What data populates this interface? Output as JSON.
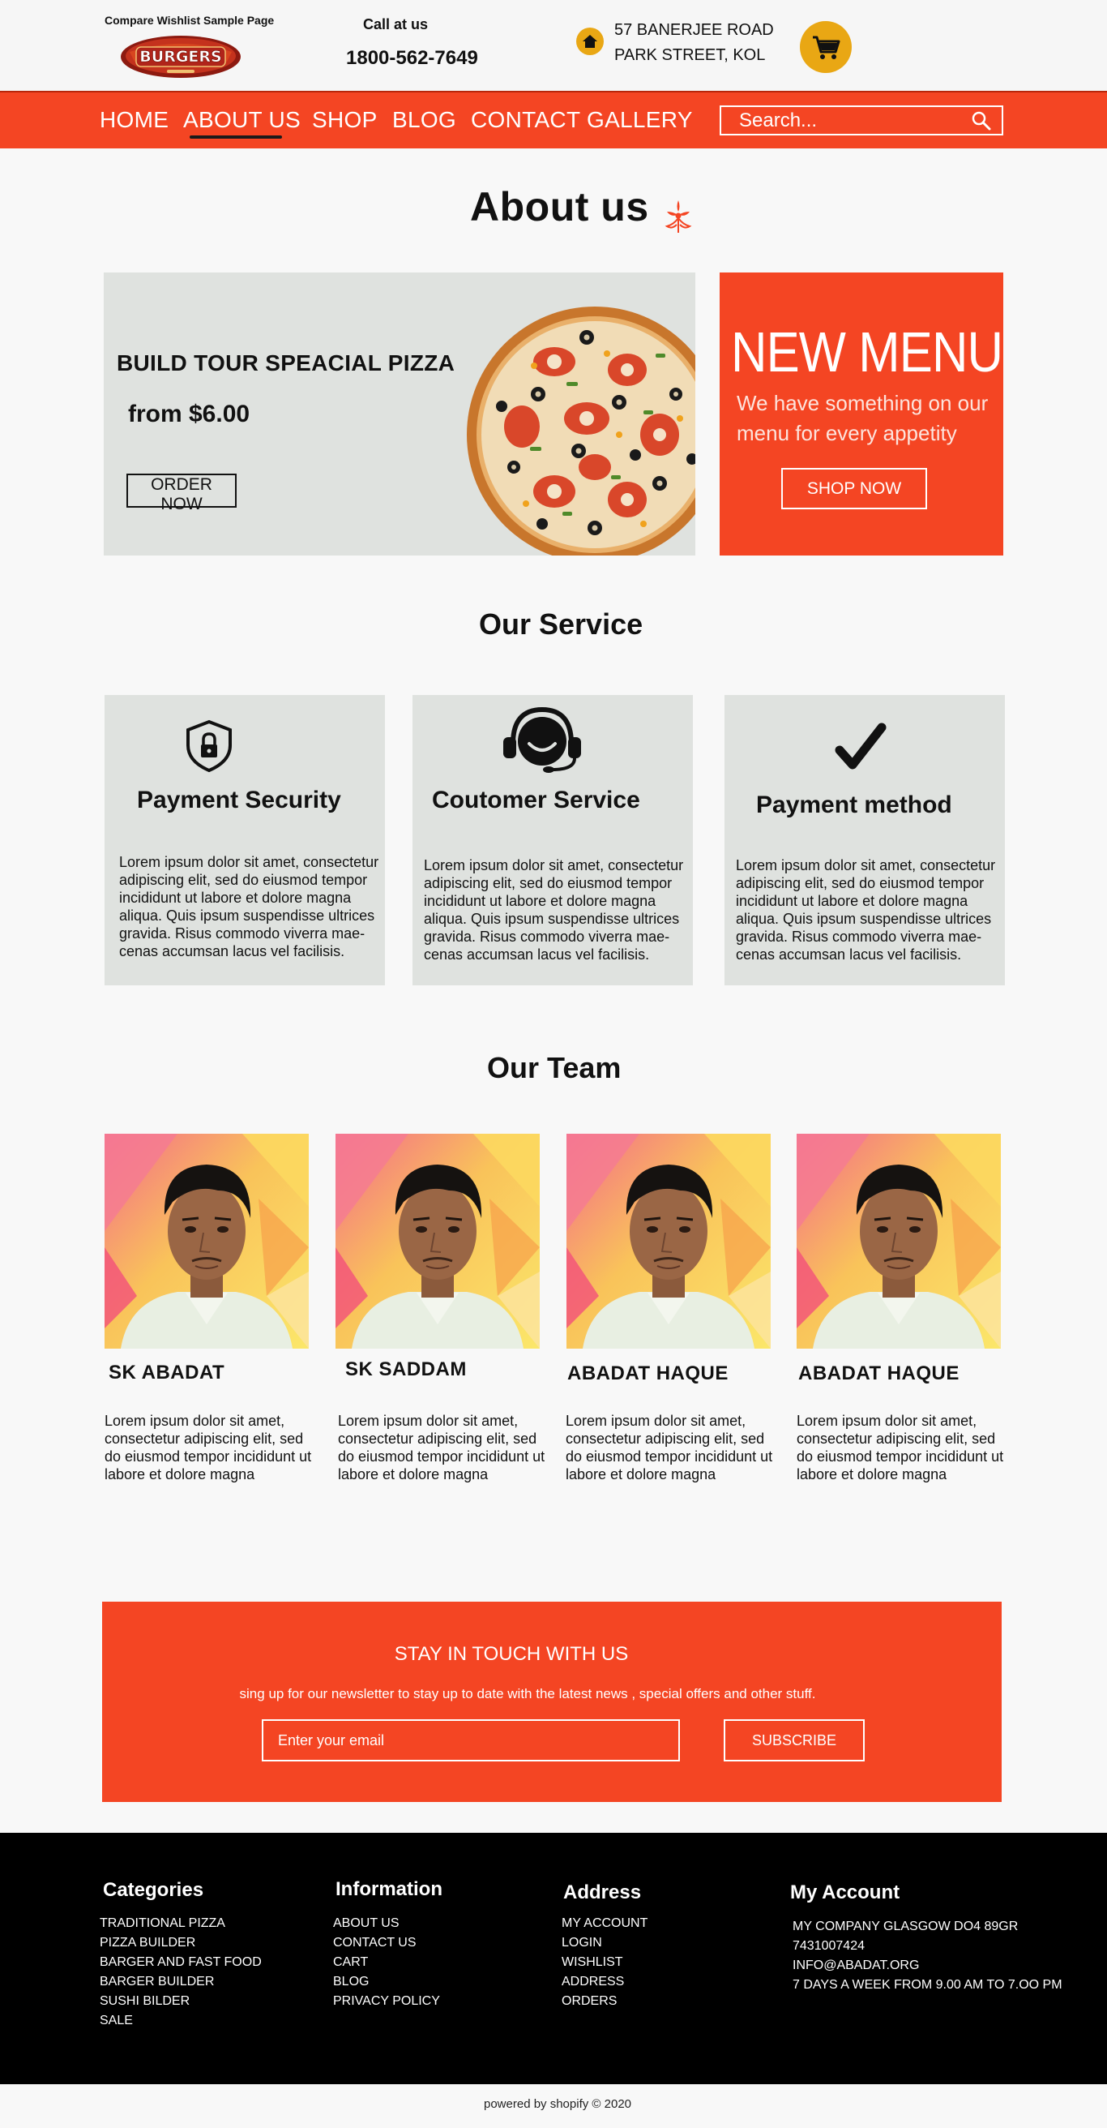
{
  "header": {
    "wishlist_text": "Compare Wishlist Sample Page",
    "logo_text": "BURGERS",
    "call_label": "Call at us",
    "phone": "1800-562-7649",
    "address_line1": "57 BANERJEE ROAD",
    "address_line2": "PARK STREET, KOL"
  },
  "nav": {
    "items": [
      {
        "label": "HOME"
      },
      {
        "label": "ABOUT US"
      },
      {
        "label": "SHOP"
      },
      {
        "label": "BLOG"
      },
      {
        "label": "CONTACT"
      },
      {
        "label": "GALLERY"
      }
    ],
    "active": "ABOUT US",
    "search_placeholder": "Search..."
  },
  "about": {
    "title": "About us"
  },
  "promo": {
    "title": "BUILD TOUR SPEACIAL PIZZA",
    "price": "from $6.00",
    "button": "ORDER NOW"
  },
  "new_menu": {
    "title": "NEW MENU",
    "text": "We have something on our menu for every appetity",
    "button": "SHOP NOW"
  },
  "services": {
    "title": "Our Service",
    "items": [
      {
        "title": "Payment Security",
        "icon": "shield-lock-icon",
        "text": "Lorem ipsum dolor sit amet, consectetur adipiscing elit, sed do eiusmod tempor incididunt ut labore et dolore magna aliqua. Quis ipsum suspendisse ultrices gravida. Risus commodo viverra mae-cenas accumsan lacus vel facilisis."
      },
      {
        "title": "Coutomer Service",
        "icon": "headset-icon",
        "text": "Lorem ipsum dolor sit amet, consectetur adipiscing elit, sed do eiusmod tempor incididunt ut labore et dolore magna aliqua. Quis ipsum suspendisse ultrices gravida. Risus commodo viverra mae-cenas accumsan lacus vel facilisis."
      },
      {
        "title": "Payment method",
        "icon": "checkmark-icon",
        "text": "Lorem ipsum dolor sit amet, consectetur adipiscing elit, sed do eiusmod tempor incididunt ut labore et dolore magna aliqua. Quis ipsum suspendisse ultrices gravida. Risus commodo viverra mae-cenas accumsan lacus vel facilisis."
      }
    ]
  },
  "team": {
    "title": "Our Team",
    "members": [
      {
        "name": "SK ABADAT",
        "text": "Lorem ipsum dolor sit amet, consectetur adipiscing elit, sed do eiusmod tempor incididunt ut labore et dolore magna"
      },
      {
        "name": "SK SADDAM",
        "text": "Lorem ipsum dolor sit amet, consectetur adipiscing elit, sed do eiusmod tempor incididunt ut labore et dolore magna"
      },
      {
        "name": "ABADAT HAQUE",
        "text": "Lorem ipsum dolor sit amet, consectetur adipiscing elit, sed do eiusmod tempor incididunt ut labore et dolore magna"
      },
      {
        "name": "ABADAT HAQUE",
        "text": "Lorem ipsum dolor sit amet, consectetur adipiscing elit, sed do eiusmod tempor incididunt ut labore et dolore magna"
      }
    ]
  },
  "newsletter": {
    "title": "STAY IN TOUCH WITH US",
    "subtitle": "sing up for our newsletter to stay up to date with the latest news , special offers and other stuff.",
    "placeholder": "Enter your email",
    "button": "SUBSCRIBE"
  },
  "footer": {
    "categories": {
      "title": "Categories",
      "items": [
        "TRADITIONAL PIZZA",
        "PIZZA BUILDER",
        "BARGER AND FAST FOOD",
        "BARGER BUILDER",
        "SUSHI BILDER",
        "SALE"
      ]
    },
    "information": {
      "title": "Information",
      "items": [
        "ABOUT US",
        "CONTACT US",
        "CART",
        "BLOG",
        "PRIVACY POLICY"
      ]
    },
    "address": {
      "title": "Address",
      "items": [
        "MY ACCOUNT",
        "LOGIN",
        "WISHLIST",
        "ADDRESS",
        "ORDERS"
      ]
    },
    "account": {
      "title": "My Account",
      "items": [
        "MY COMPANY GLASGOW DO4 89GR",
        "7431007424",
        "INFO@ABADAT.ORG",
        "7 DAYS A WEEK FROM 9.00 AM TO 7.OO PM"
      ]
    },
    "copyright": "powered by shopify  ©  2020"
  },
  "colors": {
    "accent": "#f44523",
    "gold": "#e9a714",
    "card_gray": "#dfe2df",
    "footer_bg": "#000000"
  }
}
